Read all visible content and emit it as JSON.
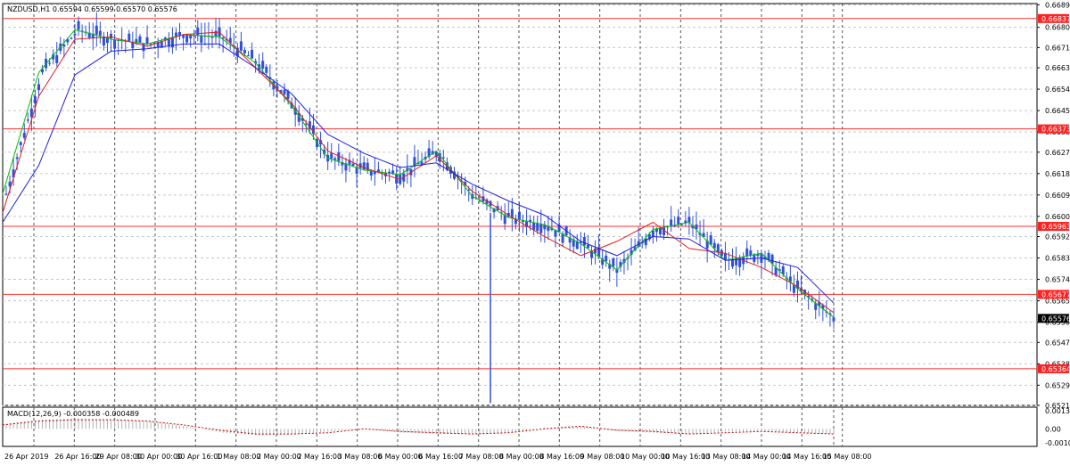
{
  "window": {
    "title": "NZDUSD,H1  0.65594 0.65599 0.65570 0.65576"
  },
  "colors": {
    "background": "#ffffff",
    "grid": "#c8c8c8",
    "candle": "#3050d8",
    "ma_fast": "#00c000",
    "ma_mid": "#e02020",
    "ma_slow": "#2020e0",
    "level_line": "#ff3030",
    "level_label_bg": "#ff2020",
    "current_label_bg": "#000000",
    "macd_line": "#c00000"
  },
  "chart_data": [
    {
      "type": "line",
      "title": "NZDUSD,H1  0.65594 0.65599 0.65570 0.65576",
      "ylim": [
        0.6521,
        0.669
      ],
      "y_ticks": [
        "0.66895",
        "0.66800",
        "0.66715",
        "0.66630",
        "0.66540",
        "0.66450",
        "0.66360",
        "0.66275",
        "0.66185",
        "0.66095",
        "0.66005",
        "0.65920",
        "0.65830",
        "0.65740",
        "0.65650",
        "0.65560",
        "0.65475",
        "0.65385",
        "0.65295",
        "0.65210"
      ],
      "x_ticks": [
        "26 Apr 2019",
        "26 Apr 16:00",
        "29 Apr 08:00",
        "30 Apr 00:00",
        "30 Apr 16:00",
        "1 May 08:00",
        "2 May 00:00",
        "2 May 16:00",
        "3 May 08:00",
        "6 May 00:00",
        "6 May 16:00",
        "7 May 08:00",
        "8 May 00:00",
        "8 May 16:00",
        "9 May 08:00",
        "10 May 00:00",
        "10 May 16:00",
        "13 May 08:00",
        "14 May 00:00",
        "14 May 16:00",
        "15 May 08:00"
      ],
      "horizontal_levels": [
        "0.66837",
        "0.66373",
        "0.65963",
        "0.65677",
        "0.65364"
      ],
      "current_price": "0.65576",
      "x": [
        0,
        10,
        20,
        30,
        40,
        50,
        60,
        70,
        80,
        90,
        100,
        110,
        120,
        130,
        140,
        150,
        160,
        170,
        180,
        190,
        200,
        210,
        220,
        230
      ],
      "series": [
        {
          "values": [
            0.661,
            0.6661,
            0.6679,
            0.6675,
            0.6673,
            0.6677,
            0.6676,
            0.6665,
            0.6647,
            0.6625,
            0.662,
            0.6618,
            0.6628,
            0.6609,
            0.66,
            0.6597,
            0.6589,
            0.6578,
            0.6595,
            0.6598,
            0.6582,
            0.6585,
            0.657,
            0.6558
          ]
        },
        {
          "values": [
            0.6602,
            0.6651,
            0.6675,
            0.6676,
            0.6672,
            0.6677,
            0.6678,
            0.6663,
            0.6648,
            0.6628,
            0.6621,
            0.6616,
            0.6626,
            0.6611,
            0.6601,
            0.6592,
            0.6584,
            0.659,
            0.6598,
            0.6587,
            0.6585,
            0.6579,
            0.6571,
            0.656
          ]
        },
        {
          "values": [
            0.6598,
            0.6622,
            0.666,
            0.667,
            0.6671,
            0.6673,
            0.6673,
            0.6663,
            0.6652,
            0.6635,
            0.6627,
            0.6621,
            0.6623,
            0.6614,
            0.6607,
            0.6601,
            0.659,
            0.6584,
            0.6592,
            0.6591,
            0.6582,
            0.6583,
            0.6579,
            0.6564
          ]
        }
      ]
    },
    {
      "type": "bar",
      "title": "MACD(12,26,9) -0.000358 -0.000489",
      "ylim": [
        -0.001076,
        0.00139
      ],
      "y_ticks": [
        "0.00139",
        "0.00",
        "-0.001076"
      ],
      "x": [
        0,
        10,
        20,
        30,
        40,
        50,
        60,
        70,
        80,
        90,
        100,
        110,
        120,
        130,
        140,
        150,
        160,
        170,
        180,
        190,
        200,
        210,
        220,
        230
      ],
      "values": [
        0.0004,
        0.0007,
        0.0008,
        0.0007,
        0.0006,
        0.0002,
        -0.0003,
        -0.0005,
        -0.0004,
        -0.0002,
        0.0,
        -0.0003,
        -0.0004,
        -0.0004,
        -0.0003,
        0.0001,
        0.0002,
        -0.0002,
        -0.0003,
        -0.0004,
        -0.0002,
        -0.0002,
        -0.0003,
        -0.0004
      ],
      "signal": [
        0.0003,
        0.0006,
        0.0007,
        0.0007,
        0.0006,
        0.0003,
        -0.0001,
        -0.0004,
        -0.0004,
        -0.0003,
        0.0,
        -0.0002,
        -0.0003,
        -0.0004,
        -0.0003,
        0.0,
        0.0002,
        -0.0001,
        -0.0002,
        -0.0004,
        -0.0003,
        -0.0002,
        -0.0003,
        -0.0004
      ]
    }
  ]
}
